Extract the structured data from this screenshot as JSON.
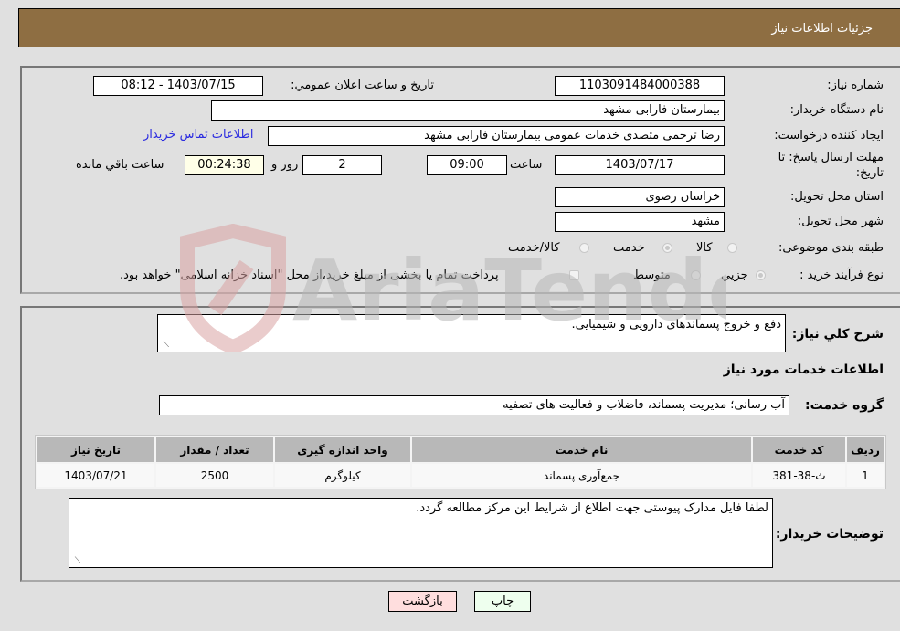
{
  "header": {
    "title": "جزئیات اطلاعات نیاز"
  },
  "details": {
    "need_number_label": "شماره نیاز:",
    "need_number": "1103091484000388",
    "announce_label": "تاريخ و ساعت اعلان عمومي:",
    "announce_value": "1403/07/15 - 08:12",
    "buyer_org_label": "نام دستگاه خريدار:",
    "buyer_org": "بیمارستان فارابی مشهد",
    "creator_label": "ايجاد کننده درخواست:",
    "creator": "رضا ترحمی متصدی خدمات عمومی بیمارستان فارابی مشهد",
    "buyer_contact_link": "اطلاعات تماس خريدار",
    "deadline_label_1": "مهلت ارسال پاسخ: تا",
    "deadline_label_2": "تاريخ:",
    "deadline_date": "1403/07/17",
    "time_label": "ساعت",
    "deadline_time": "09:00",
    "days_value": "2",
    "days_label": "روز و",
    "remaining_time": "00:24:38",
    "remaining_label": "ساعت باقي مانده",
    "province_label": "استان محل تحويل:",
    "province": "خراسان رضوی",
    "city_label": "شهر محل تحويل:",
    "city": "مشهد",
    "category_label": "طبقه بندی موضوعی:",
    "category_options": [
      {
        "label": "کالا",
        "selected": false
      },
      {
        "label": "خدمت",
        "selected": true
      },
      {
        "label": "کالا/خدمت",
        "selected": false
      }
    ],
    "process_label": "نوع فرآيند خريد :",
    "process_options": [
      {
        "label": "جزيي",
        "selected": true
      },
      {
        "label": "متوسط",
        "selected": false
      }
    ],
    "treasury_note": "پرداخت تمام يا بخشی از مبلغ خريد،از محل \"اسناد خزانه اسلامی\" خواهد بود."
  },
  "summary": {
    "description_label": "شرح کلي نياز:",
    "description": "دفع و خروج پسماندهای دارویی و شیمیایی.",
    "services_heading": "اطلاعات خدمات مورد نياز",
    "service_group_label": "گروه خدمت:",
    "service_group": "آب رسانی؛ مدیریت پسماند، فاضلاب و فعالیت های تصفیه"
  },
  "table": {
    "headers": [
      "رديف",
      "کد خدمت",
      "نام خدمت",
      "واحد اندازه گيری",
      "تعداد / مقدار",
      "تاريخ نياز"
    ],
    "rows": [
      [
        "1",
        "ث-38-381",
        "جمع‌آوری پسماند",
        "کیلوگرم",
        "2500",
        "1403/07/21"
      ]
    ]
  },
  "buyer_notes": {
    "label": "توضيحات خريدار:",
    "text": "لطفا فایل مدارک پیوستی جهت اطلاع از شرایط این مرکز مطالعه گردد."
  },
  "buttons": {
    "print": "چاپ",
    "back": "بازگشت"
  },
  "watermark": {
    "text": "AriaTender.neT"
  }
}
